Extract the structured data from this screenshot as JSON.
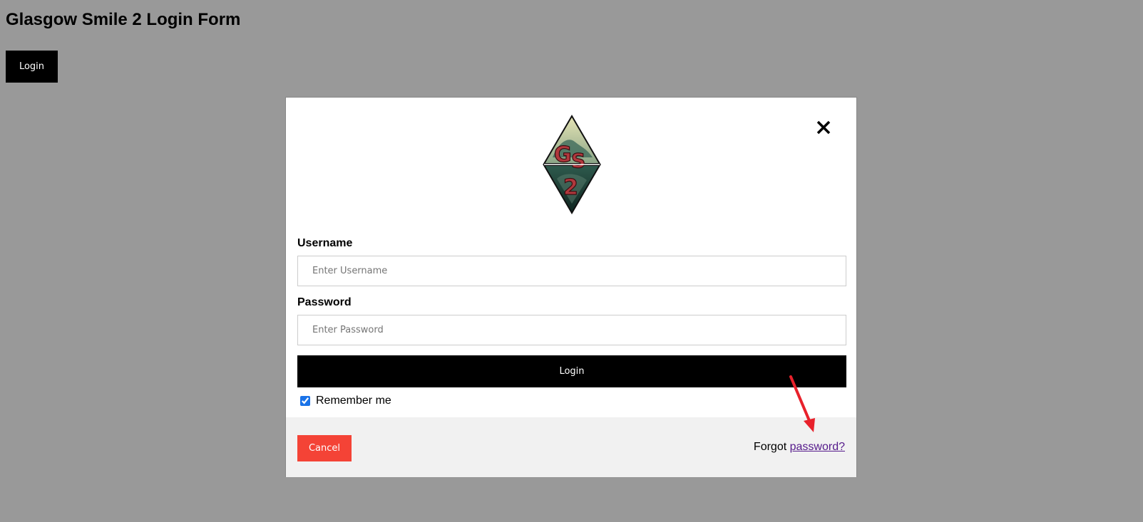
{
  "page": {
    "title": "Glasgow Smile 2 Login Form",
    "open_login_label": "Login"
  },
  "modal": {
    "logo_text": "GS2",
    "username": {
      "label": "Username",
      "placeholder": "Enter Username",
      "value": ""
    },
    "password": {
      "label": "Password",
      "placeholder": "Enter Password",
      "value": ""
    },
    "submit_label": "Login",
    "remember": {
      "label": "Remember me",
      "checked": true
    },
    "footer": {
      "cancel_label": "Cancel",
      "forgot_prefix": "Forgot",
      "forgot_link": "password?"
    }
  },
  "colors": {
    "overlay_bg": "#999999",
    "cancel_bg": "#f44336",
    "primary_bg": "#000000",
    "link": "#551a8b",
    "annotation_arrow": "#e8212b"
  },
  "icons": {
    "close": "close-icon",
    "checkbox": "checkbox-checked-icon",
    "annotation": "red-arrow-icon"
  }
}
